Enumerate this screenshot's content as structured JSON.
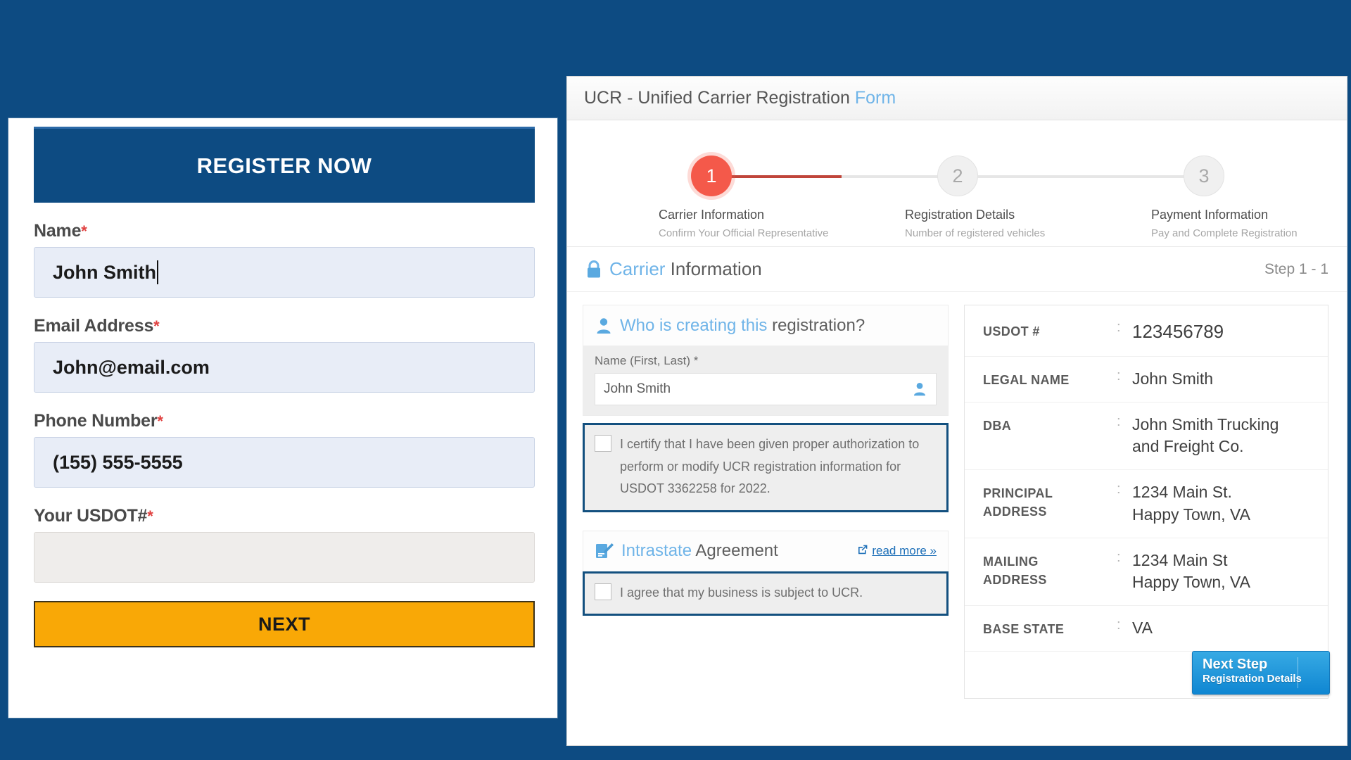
{
  "left_form": {
    "banner_title": "REGISTER NOW",
    "required_mark": "*",
    "fields": [
      {
        "label": "Name",
        "value": "John Smith",
        "empty": false,
        "caret": true
      },
      {
        "label": "Email Address",
        "value": "John@email.com",
        "empty": false,
        "caret": false
      },
      {
        "label": "Phone Number",
        "value": "(155) 555-5555",
        "empty": false,
        "caret": false
      },
      {
        "label": "Your USDOT#",
        "value": "",
        "empty": true,
        "caret": false
      }
    ],
    "submit_label": "NEXT"
  },
  "ucr": {
    "window_title_main": "UCR - Unified Carrier Registration ",
    "window_title_accent": "Form",
    "stepper": [
      {
        "number": "1",
        "name": "Carrier Information",
        "sub": "Confirm Your Official Representative",
        "state": "active"
      },
      {
        "number": "2",
        "name": "Registration Details",
        "sub": "Number of registered vehicles",
        "state": "idle"
      },
      {
        "number": "3",
        "name": "Payment Information",
        "sub": "Pay and Complete Registration",
        "state": "idle"
      }
    ],
    "section": {
      "title_accent": "Carrier",
      "title_rest": " Information",
      "step_counter": "Step 1 - 1"
    },
    "who_panel": {
      "title_accent": "Who is creating this",
      "title_rest": " registration?",
      "name_label": "Name (First, Last) *",
      "name_value": "John Smith",
      "certify_text": "I certify that I have been given proper authorization to perform or modify UCR registration information for USDOT 3362258 for 2022.",
      "certify_checked": false
    },
    "intrastate_panel": {
      "title_accent": "Intrastate",
      "title_rest": " Agreement",
      "read_more": "read more »",
      "agree_text": "I agree that my business is subject to UCR.",
      "agree_checked": false
    },
    "details": [
      {
        "key": "USDOT #",
        "value": "123456789",
        "big": true
      },
      {
        "key": "LEGAL NAME",
        "value": "John Smith",
        "big": false
      },
      {
        "key": "DBA",
        "value": "John Smith Trucking\nand Freight Co.",
        "big": false
      },
      {
        "key": "PRINCIPAL\nADDRESS",
        "value": "1234 Main St.\nHappy Town, VA",
        "big": false
      },
      {
        "key": "MAILING\nADDRESS",
        "value": "1234 Main St\nHappy Town, VA",
        "big": false
      },
      {
        "key": "BASE STATE",
        "value": "VA",
        "big": false
      }
    ],
    "next_step": {
      "line1": "Next Step",
      "line2": "Registration Details"
    }
  },
  "colors": {
    "page_background": "#0d4b82",
    "banner_blue": "#0d4b82",
    "next_orange": "#f9a806",
    "accent_cyan": "#6fb4e8",
    "step_active_red": "#f4594a",
    "step_line_red": "#c0453a",
    "highlight_border": "#13507f",
    "next_step_blue": "#1c96dc",
    "required_red": "#e0403f"
  }
}
